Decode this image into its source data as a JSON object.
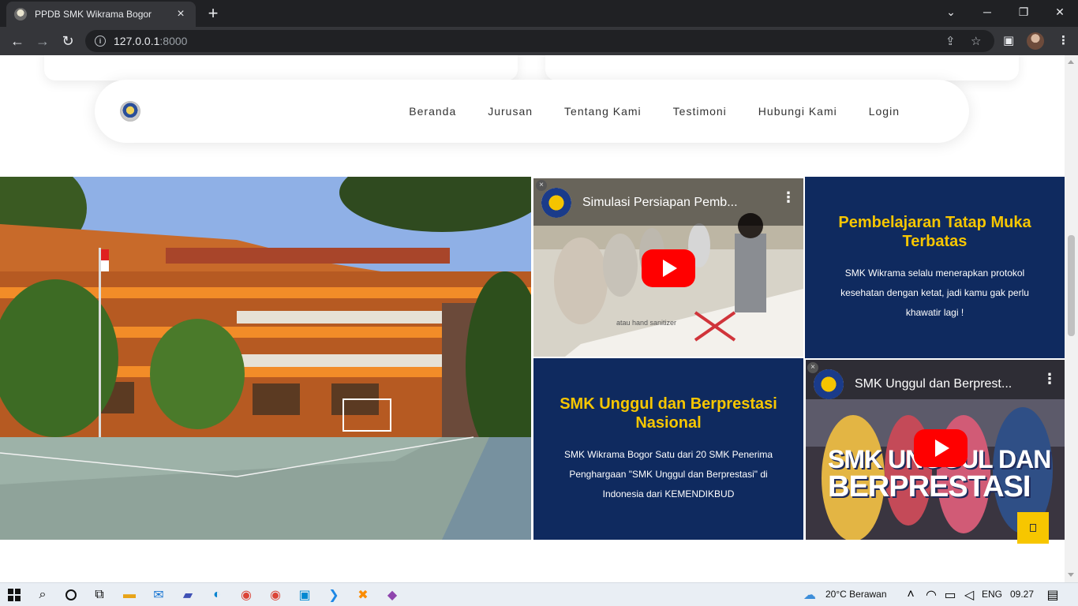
{
  "browser": {
    "tab_title": "PPDB SMK Wikrama Bogor",
    "tab_close": "×",
    "new_tab": "+",
    "url_host": "127.0.0.1",
    "url_port": ":8000",
    "controls": {
      "minimize": "─",
      "restore": "❐",
      "close": "✕",
      "tab_search": "⌄"
    },
    "nav": {
      "back": "←",
      "forward": "→",
      "reload": "↻"
    }
  },
  "navbar": {
    "links": [
      "Beranda",
      "Jurusan",
      "Tentang Kami",
      "Testimoni",
      "Hubungi Kami",
      "Login"
    ]
  },
  "hero": {
    "panel_protokol": {
      "title": "Pembelajaran Tatap Muka Terbatas",
      "text": "SMK Wikrama selalu menerapkan protokol kesehatan dengan ketat, jadi kamu gak perlu khawatir lagi !"
    },
    "panel_unggul": {
      "title": "SMK Unggul dan Berprestasi Nasional",
      "text": "SMK Wikrama Bogor Satu dari 20 SMK Penerima Penghargaan \"SMK Unggul dan Berprestasi\" di Indonesia dari KEMENDIKBUD"
    },
    "video_1": {
      "title": "Simulasi Persiapan Pemb...",
      "caption": "atau hand sanitizer"
    },
    "video_2": {
      "title": "SMK Unggul dan Berprest...",
      "overlay_line1": "SMK UNGGUL DAN",
      "overlay_line2": "BERPRESTASI"
    }
  },
  "taskbar": {
    "weather": "20°C  Berawan",
    "lang": "ENG",
    "time": "09.27"
  },
  "colors": {
    "navy": "#0f2a5f",
    "gold": "#f7c600",
    "youtube_red": "#ff0000"
  }
}
